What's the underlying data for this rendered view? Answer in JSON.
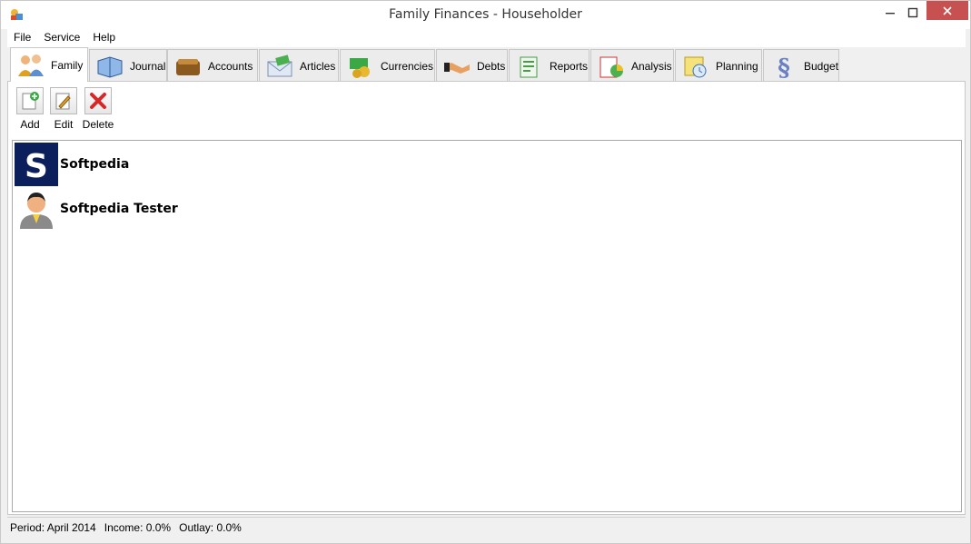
{
  "window": {
    "title": "Family Finances - Householder"
  },
  "menu": {
    "items": [
      "File",
      "Service",
      "Help"
    ]
  },
  "tabs": [
    {
      "label": "Family",
      "icon": "family-icon",
      "active": true
    },
    {
      "label": "Journal",
      "icon": "journal-icon"
    },
    {
      "label": "Accounts",
      "icon": "wallet-icon"
    },
    {
      "label": "Articles",
      "icon": "envelope-money-icon"
    },
    {
      "label": "Currencies",
      "icon": "currency-money-icon"
    },
    {
      "label": "Debts",
      "icon": "handshake-icon"
    },
    {
      "label": "Reports",
      "icon": "report-icon"
    },
    {
      "label": "Analysis",
      "icon": "analysis-chart-icon"
    },
    {
      "label": "Planning",
      "icon": "planning-clock-icon"
    },
    {
      "label": "Budget",
      "icon": "budget-section-icon"
    }
  ],
  "toolbar": {
    "add": "Add",
    "edit": "Edit",
    "delete": "Delete"
  },
  "members": [
    {
      "name": "Softpedia",
      "icon": "softpedia-logo-icon"
    },
    {
      "name": "Softpedia Tester",
      "icon": "person-avatar-icon"
    }
  ],
  "status": {
    "period": "Period: April 2014",
    "income": "Income: 0.0%",
    "outlay": "Outlay: 0.0%"
  },
  "colors": {
    "close_button": "#c75050",
    "logo_bg": "#0a1f5c"
  }
}
